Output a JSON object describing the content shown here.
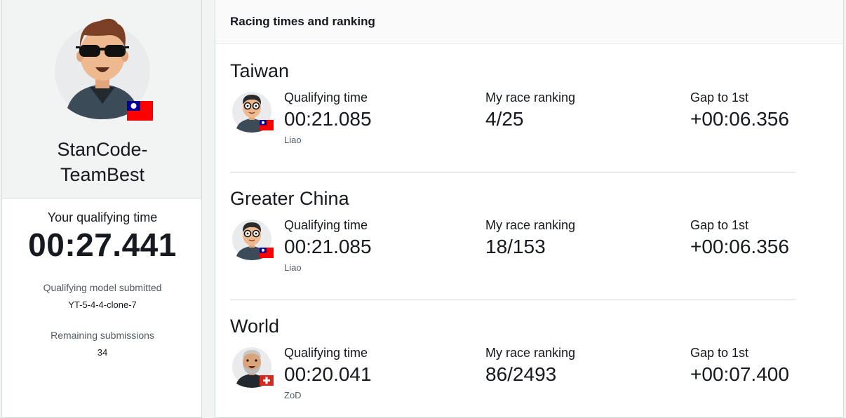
{
  "profile": {
    "username_line1": "StanCode-",
    "username_line2": "TeamBest",
    "qualifying_label": "Your qualifying time",
    "qualifying_time": "00:27.441",
    "model_label": "Qualifying model submitted",
    "model_value": "YT-5-4-4-clone-7",
    "remaining_label": "Remaining submissions",
    "remaining_value": "34"
  },
  "rankings": {
    "header": "Racing times and ranking",
    "regions": [
      {
        "name": "Taiwan",
        "leader_name": "Liao",
        "qual_label": "Qualifying time",
        "qual_value": "00:21.085",
        "rank_label": "My race ranking",
        "rank_value": "4/25",
        "gap_label": "Gap to 1st",
        "gap_value": "+00:06.356"
      },
      {
        "name": "Greater China",
        "leader_name": "Liao",
        "qual_label": "Qualifying time",
        "qual_value": "00:21.085",
        "rank_label": "My race ranking",
        "rank_value": "18/153",
        "gap_label": "Gap to 1st",
        "gap_value": "+00:06.356"
      },
      {
        "name": "World",
        "leader_name": "ZoD",
        "qual_label": "Qualifying time",
        "qual_value": "00:20.041",
        "rank_label": "My race ranking",
        "rank_value": "86/2493",
        "gap_label": "Gap to 1st",
        "gap_value": "+00:07.400"
      }
    ]
  },
  "icons": {
    "user_avatar": "avatar-sunglasses-icon",
    "taiwan_flag": "taiwan-flag-icon",
    "swiss_flag": "swiss-flag-icon",
    "leader_avatar_glasses": "avatar-glasses-icon",
    "leader_avatar_beard": "avatar-beard-icon"
  },
  "colors": {
    "flag_red": "#fe0000",
    "flag_blue": "#000095",
    "swiss_red": "#d52b1e",
    "text": "#16191f",
    "muted": "#545b64",
    "border": "#d5dbdb",
    "panel_bg": "#f2f3f3"
  }
}
